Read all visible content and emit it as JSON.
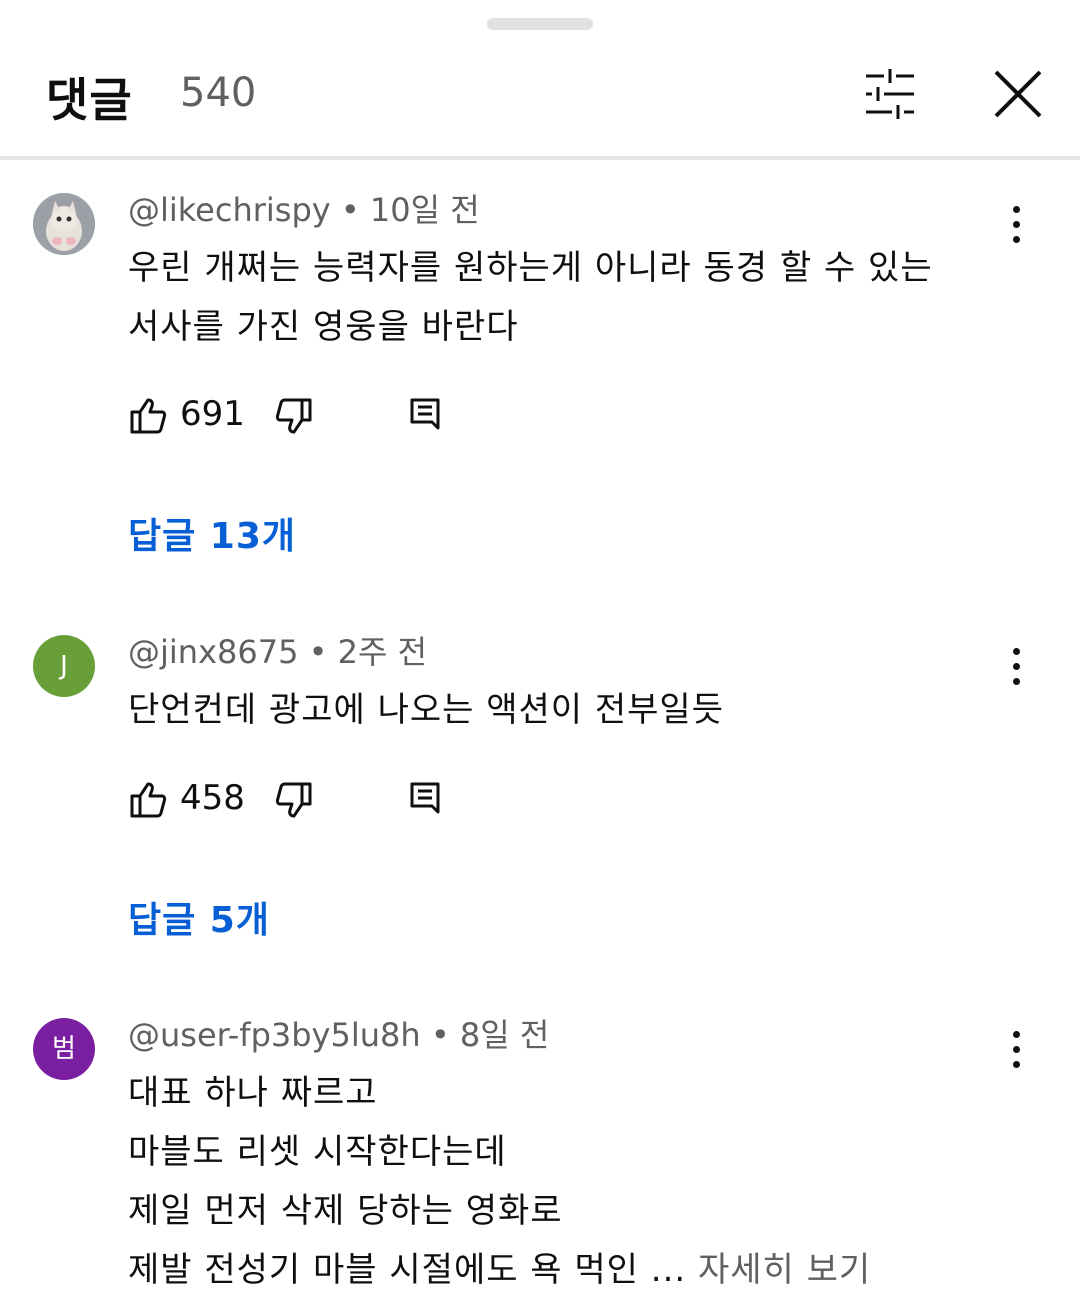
{
  "header": {
    "title": "댓글",
    "count": "540"
  },
  "comments": [
    {
      "author": "@likechrispy",
      "time": "10일 전",
      "avatar_text": "",
      "avatar_color": "#8a8f96",
      "lines": [
        "우린 개쩌는 능력자를 원하는게 아니라 동경 할 수 있는",
        "서사를 가진 영웅을 바란다"
      ],
      "likes": "691",
      "replies": "답글 13개"
    },
    {
      "author": "@jinx8675",
      "time": "2주 전",
      "avatar_text": "J",
      "avatar_color": "#689f38",
      "lines": [
        "단언컨데 광고에 나오는 액션이 전부일듯"
      ],
      "likes": "458",
      "replies": "답글 5개"
    },
    {
      "author": "@user-fp3by5lu8h",
      "time": "8일 전",
      "avatar_text": "범",
      "avatar_color": "#7b1fa2",
      "lines": [
        "대표 하나 짜르고",
        "마블도 리셋 시작한다는데",
        "제일 먼저 삭제 당하는 영화로",
        "제발 전성기 마블 시절에도 욕 먹인 ..."
      ],
      "read_more": "자세히 보기"
    }
  ],
  "separator": "•",
  "colors": {
    "link": "#065fd4",
    "secondary_text": "#606060"
  }
}
